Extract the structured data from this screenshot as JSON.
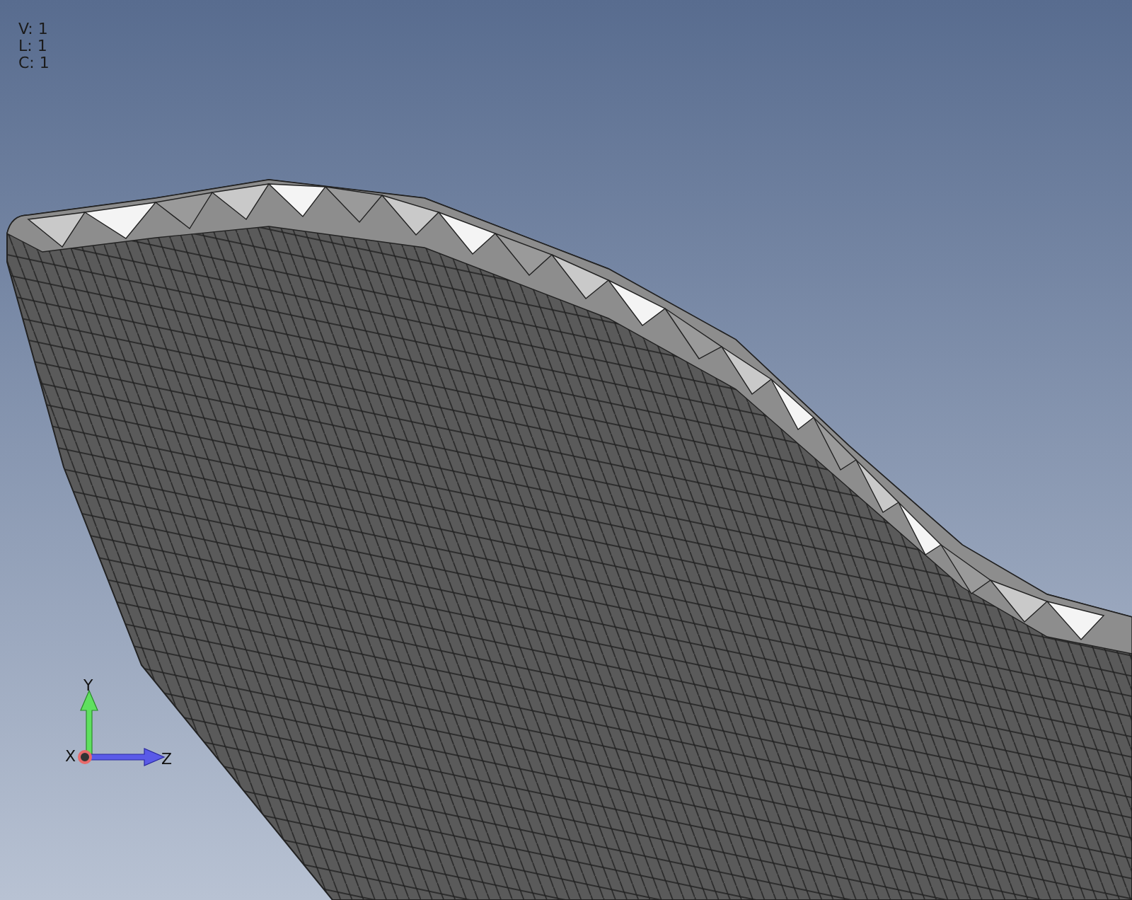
{
  "viewport": {
    "stats": [
      "V: 1",
      "L: 1",
      "C: 1"
    ],
    "axes": [
      {
        "kind": "y",
        "label": "Y"
      },
      {
        "kind": "x",
        "label": "X"
      },
      {
        "kind": "z",
        "label": "Z"
      }
    ]
  }
}
